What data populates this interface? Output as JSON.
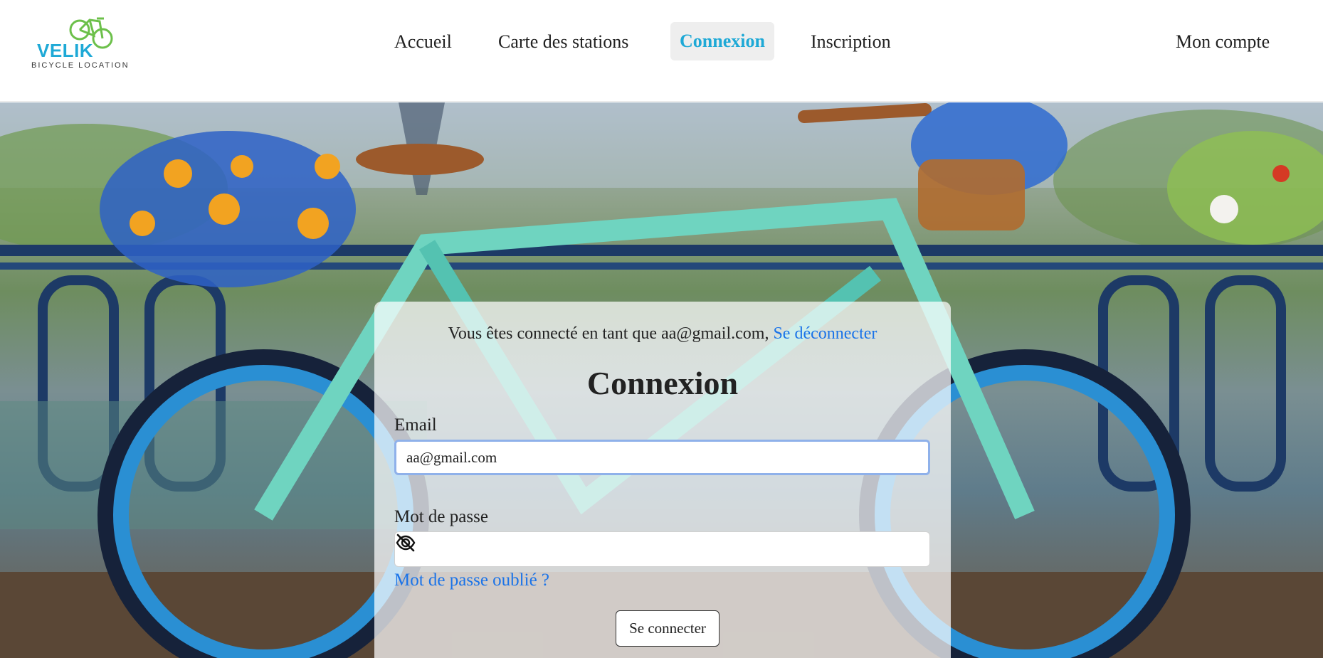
{
  "logo": {
    "name": "VELIK",
    "tagline": "BICYCLE LOCATION"
  },
  "nav": {
    "home": "Accueil",
    "stations_map": "Carte des stations",
    "login": "Connexion",
    "signup": "Inscription",
    "account": "Mon compte"
  },
  "login_card": {
    "status_prefix": "Vous êtes connecté en tant que aa@gmail.com,",
    "logout_link": "Se déconnecter",
    "title": "Connexion",
    "email_label": "Email",
    "email_value": "aa@gmail.com",
    "password_label": "Mot de passe",
    "password_value": "",
    "forgot_password": "Mot de passe oublié ?",
    "submit": "Se connecter"
  },
  "colors": {
    "brand": "#1ea9d6",
    "link": "#1a73e8",
    "logo_bike": "#6cc04a"
  },
  "icons": {
    "password_toggle": "eye-slash-icon",
    "logo": "bicycle-icon"
  }
}
